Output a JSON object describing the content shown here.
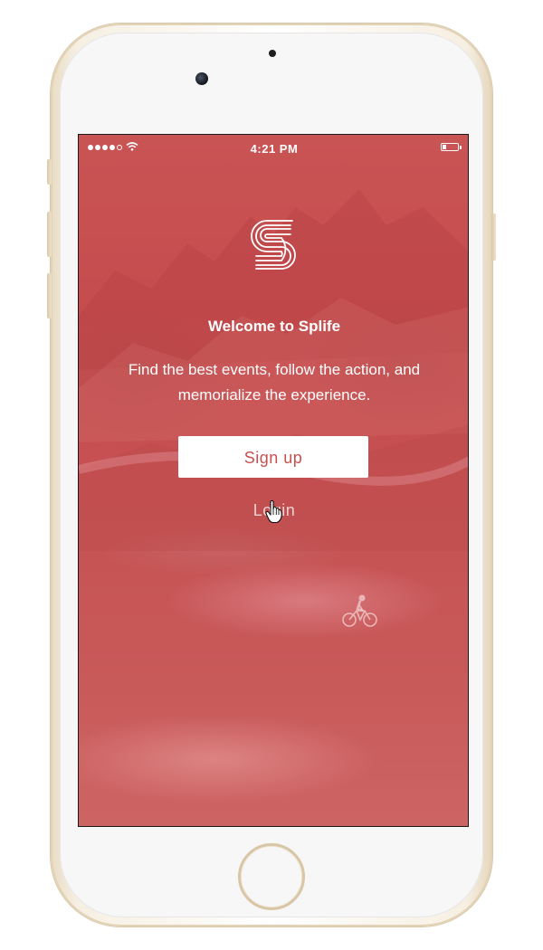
{
  "status_bar": {
    "time": "4:21 PM",
    "signal_icon": "signal-dots-icon",
    "wifi_icon": "wifi-icon",
    "battery_icon": "battery-icon"
  },
  "app": {
    "logo_icon": "splife-s-logo-icon",
    "title": "Welcome to Splife",
    "tagline": "Find the best events, follow the action, and memorialize the experience."
  },
  "actions": {
    "signup_label": "Sign up",
    "login_label": "Login"
  },
  "colors": {
    "screen_tint": "#c95454",
    "button_bg": "#ffffff",
    "button_text": "#c9504f",
    "phone_frame": "#efe3cd"
  }
}
